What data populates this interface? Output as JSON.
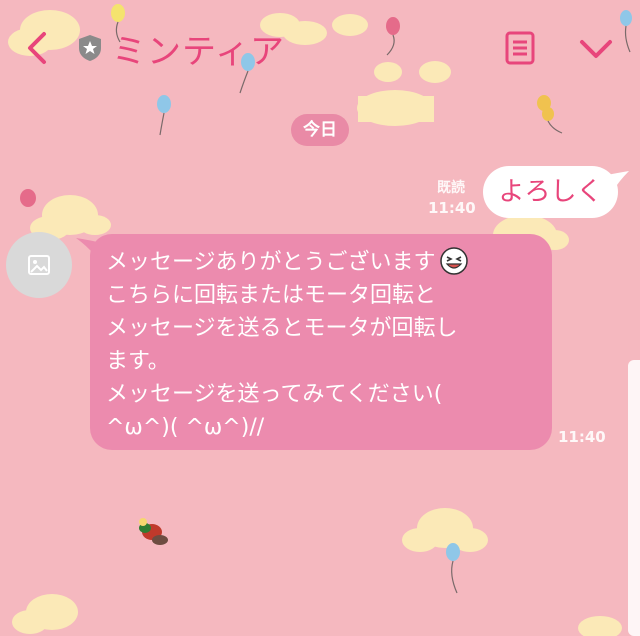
{
  "header": {
    "title": "ミンティア",
    "back_icon": "chevron-left-icon",
    "verified_icon": "shield-star-icon",
    "notes_icon": "notes-icon",
    "menu_icon": "chevron-down-icon"
  },
  "date_chip": "今日",
  "messages": [
    {
      "direction": "outgoing",
      "text": "よろしく",
      "read_label": "既読",
      "time": "11:40"
    },
    {
      "direction": "incoming",
      "avatar_icon": "image-placeholder-icon",
      "lines": [
        "メッセージありがとうございます",
        "こちらに回転またはモータ回転と",
        "メッセージを送るとモータが回転し",
        "ます。",
        "メッセージを送ってみてください(",
        "^ω^)( ^ω^)//"
      ],
      "emoji": "grinning-face-icon",
      "time": "11:40"
    }
  ],
  "colors": {
    "background": "#f5b8bf",
    "accent": "#e8457b",
    "incoming_bubble": "#ec8bae",
    "outgoing_bubble": "#ffffff",
    "date_chip": "#e98aa6"
  }
}
